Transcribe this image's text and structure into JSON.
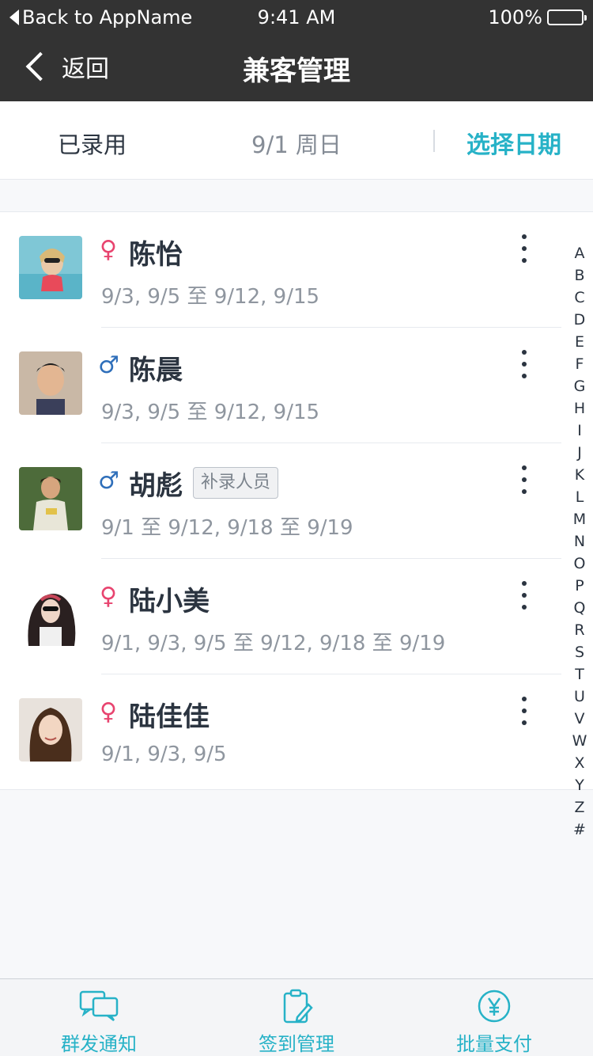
{
  "status_bar": {
    "back_app": "Back to AppName",
    "time": "9:41 AM",
    "battery": "100%"
  },
  "nav": {
    "back_label": "返回",
    "title": "兼客管理"
  },
  "filter": {
    "status": "已录用",
    "date": "9/1 周日",
    "pick_date": "选择日期"
  },
  "people": [
    {
      "name": "陈怡",
      "gender": "♀",
      "dates": "9/3, 9/5 至 9/12, 9/15",
      "tag": ""
    },
    {
      "name": "陈晨",
      "gender": "♂",
      "dates": "9/3, 9/5 至 9/12, 9/15",
      "tag": ""
    },
    {
      "name": "胡彪",
      "gender": "♂",
      "dates": "9/1 至 9/12, 9/18 至 9/19",
      "tag": "补录人员"
    },
    {
      "name": "陆小美",
      "gender": "♀",
      "dates": "9/1, 9/3, 9/5 至 9/12, 9/18 至 9/19",
      "tag": ""
    },
    {
      "name": "陆佳佳",
      "gender": "♀",
      "dates": "9/1, 9/3, 9/5",
      "tag": ""
    }
  ],
  "index_letters": [
    "A",
    "B",
    "C",
    "D",
    "E",
    "F",
    "G",
    "H",
    "I",
    "J",
    "K",
    "L",
    "M",
    "N",
    "O",
    "P",
    "Q",
    "R",
    "S",
    "T",
    "U",
    "V",
    "W",
    "X",
    "Y",
    "Z",
    "#"
  ],
  "tabs": [
    {
      "label": "群发通知",
      "icon": "chat-bubbles-icon"
    },
    {
      "label": "签到管理",
      "icon": "clipboard-pen-icon"
    },
    {
      "label": "批量支付",
      "icon": "yen-circle-icon"
    }
  ],
  "colors": {
    "accent": "#27b2c7",
    "female": "#e8446f",
    "male": "#2f6fba",
    "header": "#333333"
  }
}
